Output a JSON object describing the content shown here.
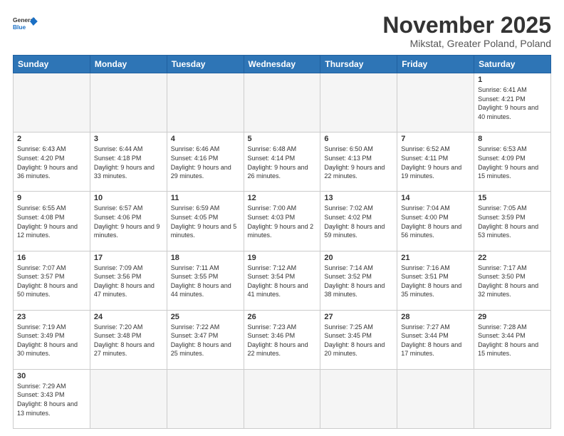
{
  "header": {
    "logo_general": "General",
    "logo_blue": "Blue",
    "month": "November 2025",
    "location": "Mikstat, Greater Poland, Poland"
  },
  "weekdays": [
    "Sunday",
    "Monday",
    "Tuesday",
    "Wednesday",
    "Thursday",
    "Friday",
    "Saturday"
  ],
  "days": {
    "1": {
      "sunrise": "6:41 AM",
      "sunset": "4:21 PM",
      "daylight": "9 hours and 40 minutes."
    },
    "2": {
      "sunrise": "6:43 AM",
      "sunset": "4:20 PM",
      "daylight": "9 hours and 36 minutes."
    },
    "3": {
      "sunrise": "6:44 AM",
      "sunset": "4:18 PM",
      "daylight": "9 hours and 33 minutes."
    },
    "4": {
      "sunrise": "6:46 AM",
      "sunset": "4:16 PM",
      "daylight": "9 hours and 29 minutes."
    },
    "5": {
      "sunrise": "6:48 AM",
      "sunset": "4:14 PM",
      "daylight": "9 hours and 26 minutes."
    },
    "6": {
      "sunrise": "6:50 AM",
      "sunset": "4:13 PM",
      "daylight": "9 hours and 22 minutes."
    },
    "7": {
      "sunrise": "6:52 AM",
      "sunset": "4:11 PM",
      "daylight": "9 hours and 19 minutes."
    },
    "8": {
      "sunrise": "6:53 AM",
      "sunset": "4:09 PM",
      "daylight": "9 hours and 15 minutes."
    },
    "9": {
      "sunrise": "6:55 AM",
      "sunset": "4:08 PM",
      "daylight": "9 hours and 12 minutes."
    },
    "10": {
      "sunrise": "6:57 AM",
      "sunset": "4:06 PM",
      "daylight": "9 hours and 9 minutes."
    },
    "11": {
      "sunrise": "6:59 AM",
      "sunset": "4:05 PM",
      "daylight": "9 hours and 5 minutes."
    },
    "12": {
      "sunrise": "7:00 AM",
      "sunset": "4:03 PM",
      "daylight": "9 hours and 2 minutes."
    },
    "13": {
      "sunrise": "7:02 AM",
      "sunset": "4:02 PM",
      "daylight": "8 hours and 59 minutes."
    },
    "14": {
      "sunrise": "7:04 AM",
      "sunset": "4:00 PM",
      "daylight": "8 hours and 56 minutes."
    },
    "15": {
      "sunrise": "7:05 AM",
      "sunset": "3:59 PM",
      "daylight": "8 hours and 53 minutes."
    },
    "16": {
      "sunrise": "7:07 AM",
      "sunset": "3:57 PM",
      "daylight": "8 hours and 50 minutes."
    },
    "17": {
      "sunrise": "7:09 AM",
      "sunset": "3:56 PM",
      "daylight": "8 hours and 47 minutes."
    },
    "18": {
      "sunrise": "7:11 AM",
      "sunset": "3:55 PM",
      "daylight": "8 hours and 44 minutes."
    },
    "19": {
      "sunrise": "7:12 AM",
      "sunset": "3:54 PM",
      "daylight": "8 hours and 41 minutes."
    },
    "20": {
      "sunrise": "7:14 AM",
      "sunset": "3:52 PM",
      "daylight": "8 hours and 38 minutes."
    },
    "21": {
      "sunrise": "7:16 AM",
      "sunset": "3:51 PM",
      "daylight": "8 hours and 35 minutes."
    },
    "22": {
      "sunrise": "7:17 AM",
      "sunset": "3:50 PM",
      "daylight": "8 hours and 32 minutes."
    },
    "23": {
      "sunrise": "7:19 AM",
      "sunset": "3:49 PM",
      "daylight": "8 hours and 30 minutes."
    },
    "24": {
      "sunrise": "7:20 AM",
      "sunset": "3:48 PM",
      "daylight": "8 hours and 27 minutes."
    },
    "25": {
      "sunrise": "7:22 AM",
      "sunset": "3:47 PM",
      "daylight": "8 hours and 25 minutes."
    },
    "26": {
      "sunrise": "7:23 AM",
      "sunset": "3:46 PM",
      "daylight": "8 hours and 22 minutes."
    },
    "27": {
      "sunrise": "7:25 AM",
      "sunset": "3:45 PM",
      "daylight": "8 hours and 20 minutes."
    },
    "28": {
      "sunrise": "7:27 AM",
      "sunset": "3:44 PM",
      "daylight": "8 hours and 17 minutes."
    },
    "29": {
      "sunrise": "7:28 AM",
      "sunset": "3:44 PM",
      "daylight": "8 hours and 15 minutes."
    },
    "30": {
      "sunrise": "7:29 AM",
      "sunset": "3:43 PM",
      "daylight": "8 hours and 13 minutes."
    }
  }
}
